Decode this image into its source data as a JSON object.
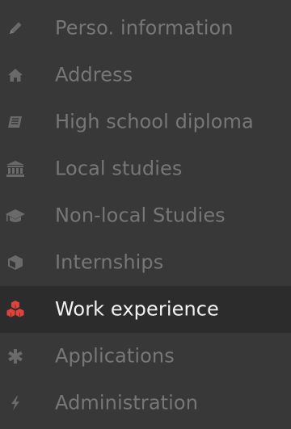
{
  "nav": {
    "items": [
      {
        "label": "Perso. information",
        "icon": "pencil-icon"
      },
      {
        "label": "Address",
        "icon": "home-icon"
      },
      {
        "label": "High school diploma",
        "icon": "book-icon"
      },
      {
        "label": "Local studies",
        "icon": "institution-icon"
      },
      {
        "label": "Non-local Studies",
        "icon": "graduation-cap-icon"
      },
      {
        "label": "Internships",
        "icon": "cube-icon"
      },
      {
        "label": "Work experience",
        "icon": "cubes-icon",
        "active": true
      },
      {
        "label": "Applications",
        "icon": "asterisk-icon"
      },
      {
        "label": "Administration",
        "icon": "bolt-icon"
      }
    ]
  },
  "colors": {
    "background": "#383838",
    "active_background": "#2c2c2c",
    "text": "#777777",
    "active_text": "#f2f2f2",
    "active_icon": "#e0433c"
  }
}
